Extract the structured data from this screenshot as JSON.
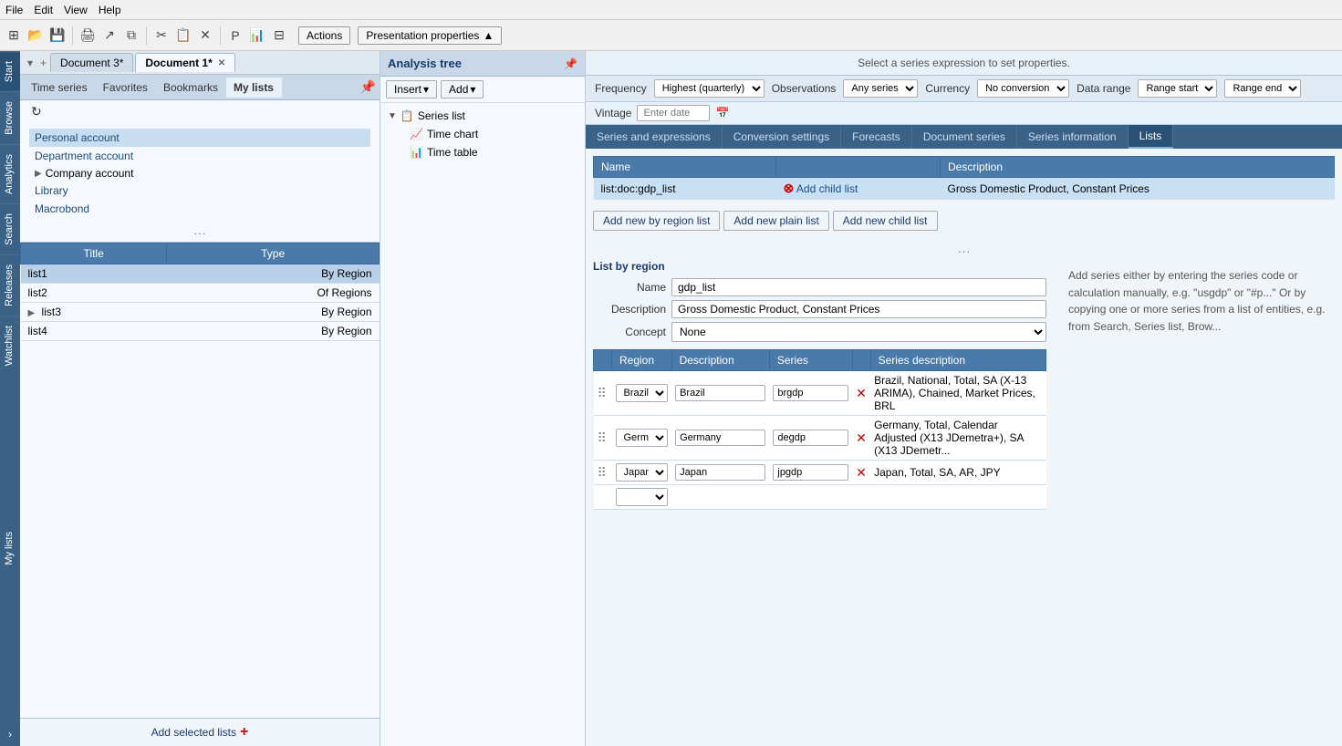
{
  "menubar": {
    "items": [
      "File",
      "Edit",
      "View",
      "Help"
    ]
  },
  "toolbar": {
    "actions_label": "Actions",
    "pres_props_label": "Presentation properties"
  },
  "doc_tabs": {
    "arrow_nav": "▾",
    "plus": "+",
    "tabs": [
      {
        "label": "Document 3*",
        "active": false,
        "closable": false
      },
      {
        "label": "Document 1*",
        "active": true,
        "closable": true
      }
    ]
  },
  "left_panel": {
    "tabs": [
      "Time series",
      "Favorites",
      "Bookmarks",
      "My lists"
    ],
    "active_tab": "My lists",
    "reload_title": "Reload",
    "accounts": [
      {
        "label": "Personal account",
        "level": 0,
        "active": true
      },
      {
        "label": "Department account",
        "level": 0
      },
      {
        "label": "Company account",
        "level": 0,
        "expandable": true
      },
      {
        "label": "Library",
        "level": 0
      },
      {
        "label": "Macrobond",
        "level": 0
      }
    ],
    "dots": "...",
    "lists_table": {
      "headers": [
        "Title",
        "Type"
      ],
      "rows": [
        {
          "title": "list1",
          "type": "By Region",
          "selected": true
        },
        {
          "title": "list2",
          "type": "Of Regions"
        },
        {
          "title": "list3",
          "type": "By Region",
          "expandable": true
        },
        {
          "title": "list4",
          "type": "By Region"
        }
      ]
    },
    "add_selected_btn": "Add selected lists",
    "add_icon": "+"
  },
  "analysis_tree": {
    "title": "Analysis tree",
    "pin_icon": "📌",
    "insert_btn": "Insert",
    "add_btn": "Add",
    "tree": {
      "root_label": "Series list",
      "children": [
        {
          "label": "Time chart",
          "indent": true
        },
        {
          "label": "Time table",
          "indent": true
        }
      ]
    }
  },
  "right_panel": {
    "info_text": "Select a series expression to set properties.",
    "props": {
      "frequency_label": "Frequency",
      "frequency_value": "Highest (quarterly)",
      "observations_label": "Observations",
      "observations_value": "Any series",
      "currency_label": "Currency",
      "currency_value": "No conversion",
      "data_range_label": "Data range",
      "data_range_start": "Range start",
      "data_range_end": "Range end"
    },
    "vintage": {
      "label": "Vintage",
      "placeholder": "Enter date",
      "calendar_icon": "📅"
    },
    "sub_tabs": [
      "Series and expressions",
      "Conversion settings",
      "Forecasts",
      "Document series",
      "Series information",
      "Lists"
    ],
    "active_sub_tab": "Lists",
    "lists_table": {
      "headers": [
        "Name",
        "",
        "Description"
      ],
      "rows": [
        {
          "name": "list:doc:gdp_list",
          "remove_icon": "✕",
          "add_child": "Add child list",
          "description": "Gross Domestic Product, Constant Prices",
          "selected": true
        }
      ]
    },
    "action_buttons": [
      "Add new by region list",
      "Add new plain list",
      "Add new child list"
    ],
    "dots": "...",
    "list_by_region": {
      "section_title": "List by region",
      "name_label": "Name",
      "name_value": "gdp_list",
      "description_label": "Description",
      "description_value": "Gross Domestic Product, Constant Prices",
      "concept_label": "Concept",
      "concept_value": "None",
      "region_table": {
        "headers": [
          "",
          "Region",
          "Description",
          "Series",
          "",
          "Series description"
        ],
        "rows": [
          {
            "region": "Brazil",
            "description": "Brazil",
            "series": "brgdp",
            "series_description": "Brazil, National, Total, SA (X-13 ARIMA), Chained, Market Prices, BRL"
          },
          {
            "region": "Germany",
            "description": "Germany",
            "series": "degdp",
            "series_description": "Germany, Total, Calendar Adjusted (X13 JDemetra+), SA (X13 JDemetr..."
          },
          {
            "region": "Japan",
            "description": "Japan",
            "series": "jpgdp",
            "series_description": "Japan, Total, SA, AR, JPY"
          }
        ]
      }
    },
    "help_text": "Add series either by entering the series code or calculation manually, e.g. \"usgdp\" or \"#p...\"\nOr by copying one or more series from a list of entities, e.g. from Search, Series list, Brow..."
  },
  "side_tabs": [
    "Start",
    "Browse",
    "Analytics",
    "Search",
    "Releases",
    "Watchlist",
    "My lists"
  ]
}
